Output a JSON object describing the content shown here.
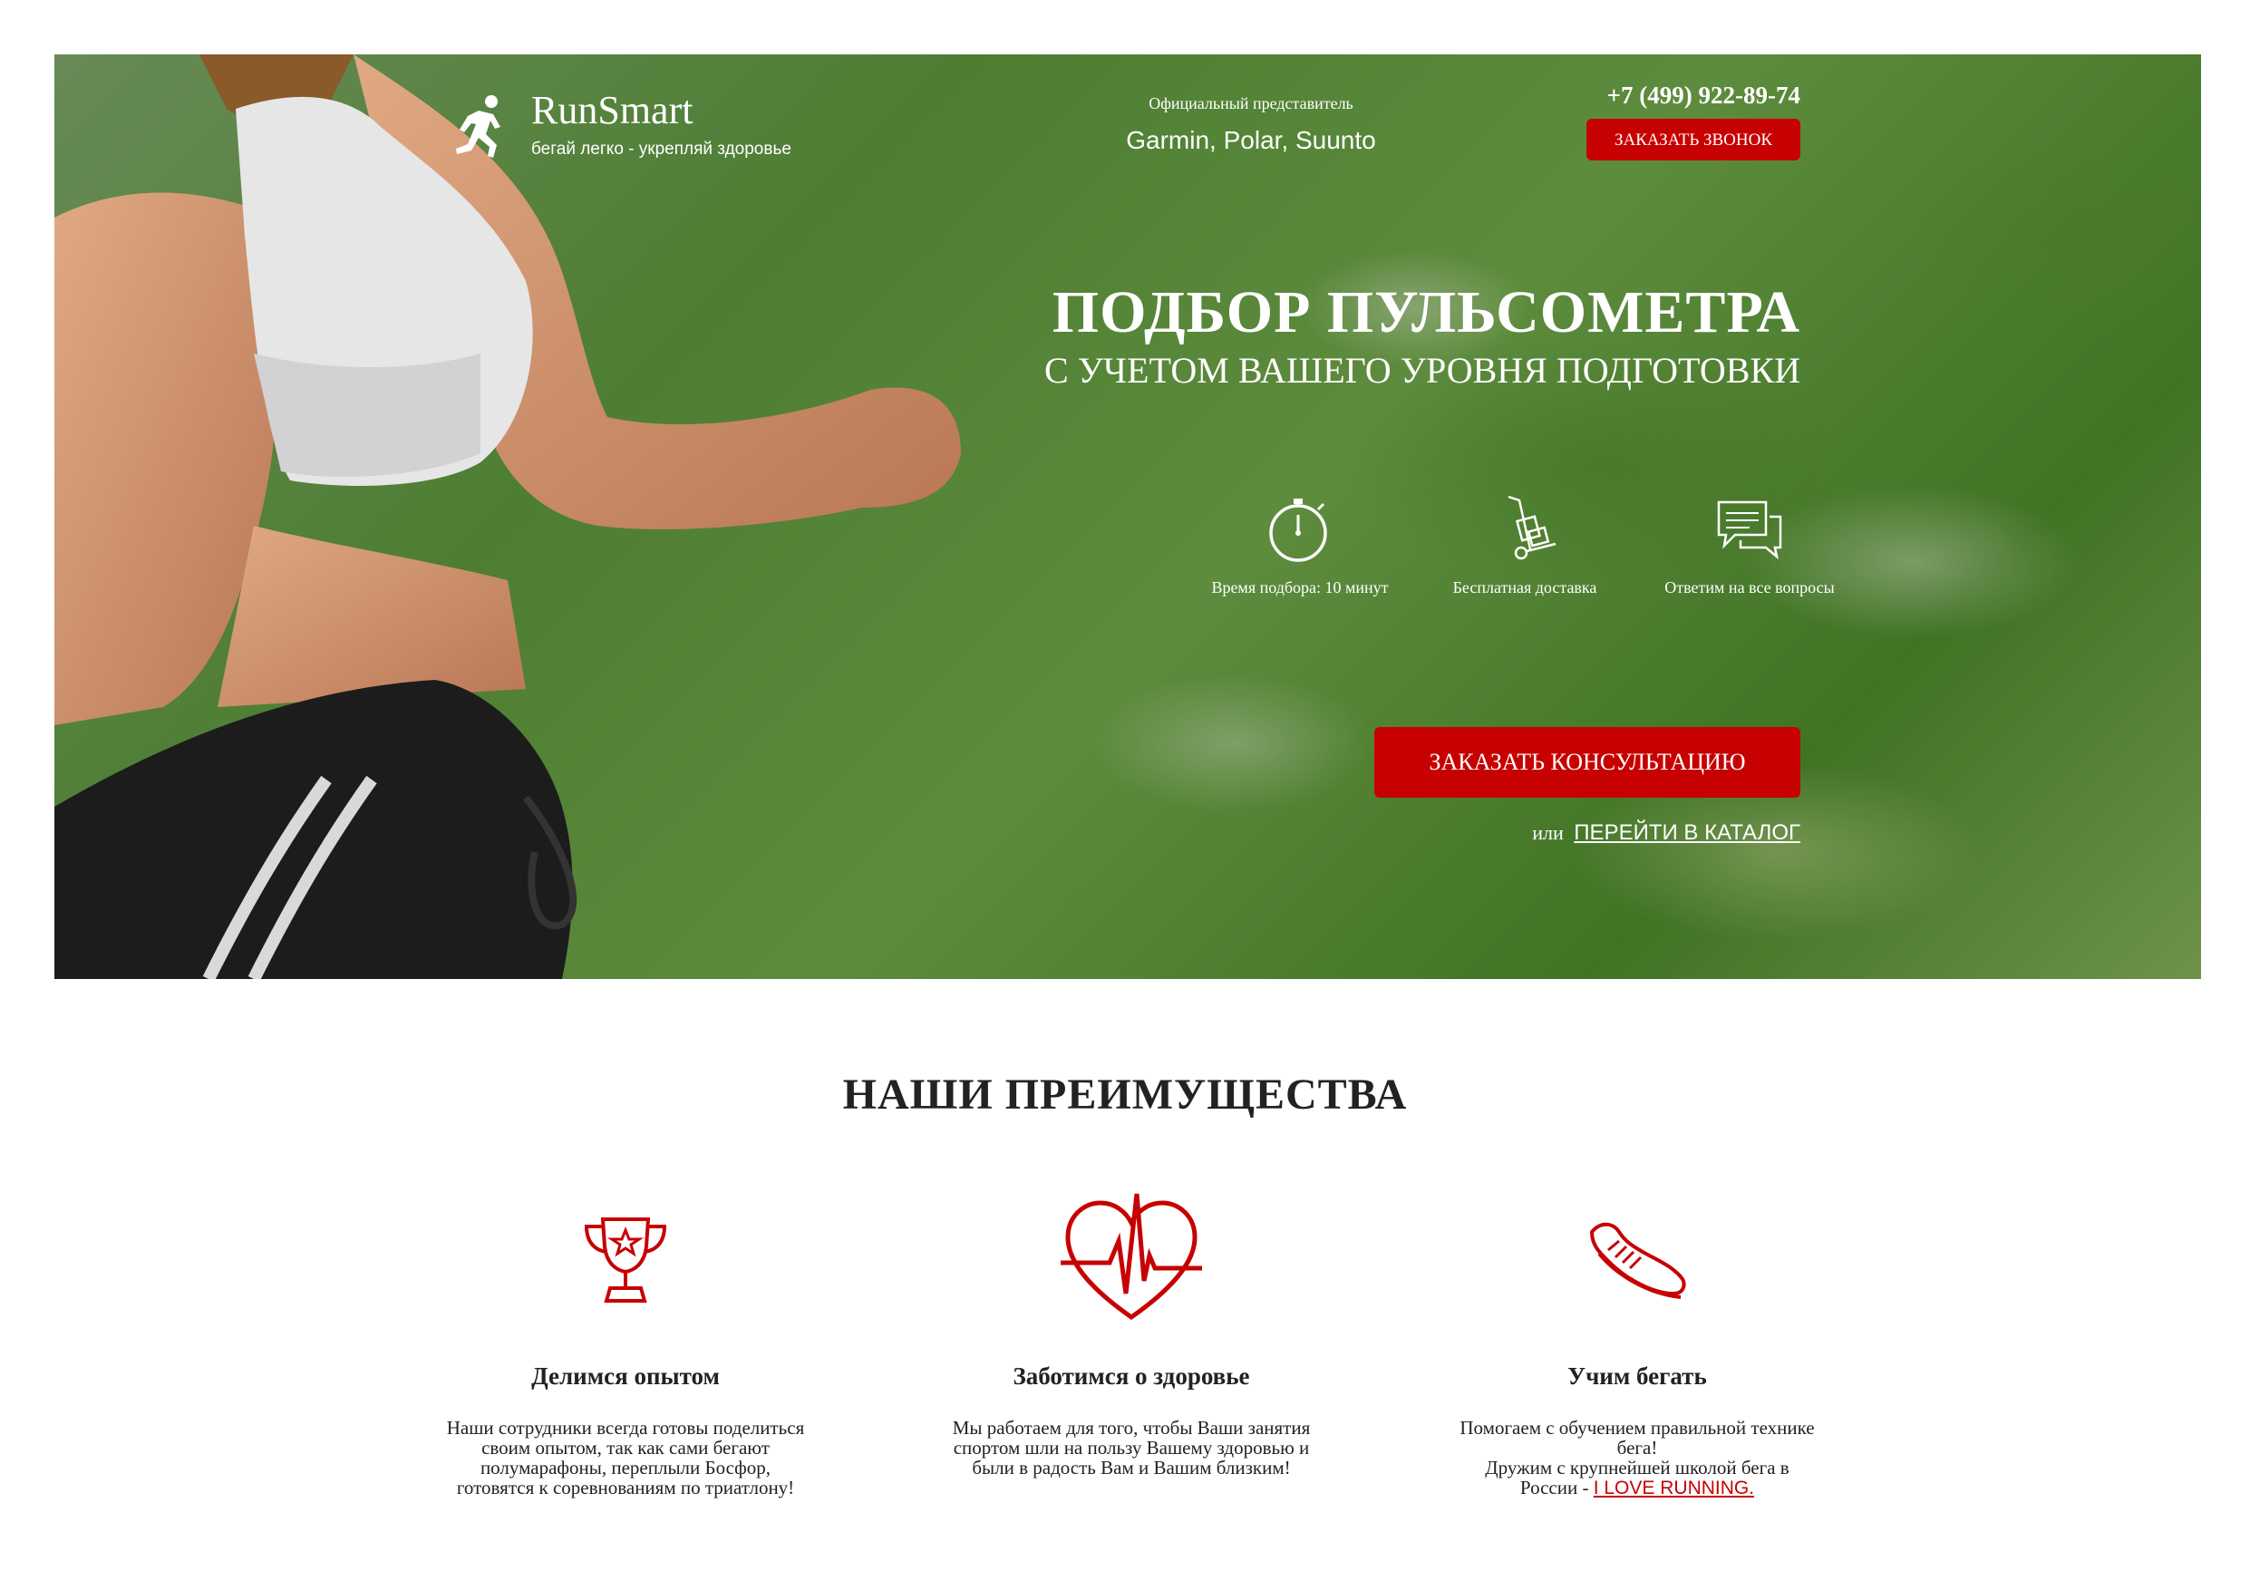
{
  "header": {
    "brand": "RunSmart",
    "slogan": "бегай легко - укрепляй здоровье",
    "rep_label": "Официальный представитель",
    "rep_brands": "Garmin, Polar, Suunto",
    "phone": "+7 (499) 922-89-74",
    "callback_label": "ЗАКАЗАТЬ ЗВОНОК"
  },
  "hero": {
    "title": "ПОДБОР ПУЛЬСОМЕТРА",
    "subtitle": "С УЧЕТОМ ВАШЕГО УРОВНЯ ПОДГОТОВКИ",
    "features": [
      {
        "icon": "stopwatch-icon",
        "text": "Время подбора: 10 минут"
      },
      {
        "icon": "delivery-cart-icon",
        "text": "Бесплатная доставка"
      },
      {
        "icon": "chat-bubbles-icon",
        "text": "Ответим на все вопросы"
      }
    ],
    "consult_label": "ЗАКАЗАТЬ КОНСУЛЬТАЦИЮ",
    "or_label": "или",
    "catalog_label": "ПЕРЕЙТИ В КАТАЛОГ"
  },
  "advantages": {
    "title": "НАШИ ПРЕИМУЩЕСТВА",
    "items": [
      {
        "icon": "trophy-icon",
        "title": "Делимся опытом",
        "text": "Наши сотрудники всегда готовы поделиться своим опытом, так как сами бегают полумарафоны, переплыли Босфор, готовятся к соревнованиям по триатлону!"
      },
      {
        "icon": "heart-pulse-icon",
        "title": "Заботимся о здоровье",
        "text": "Мы работаем для того, чтобы Ваши занятия спортом шли на пользу Вашему здоровью и были в радость Вам и Вашим близким!"
      },
      {
        "icon": "running-shoe-icon",
        "title": "Учим бегать",
        "text_1": "Помогаем с обучением правильной технике бега!",
        "text_2": "Дружим с крупнейшей школой бега в России -",
        "link": "I LOVE RUNNING."
      }
    ]
  },
  "colors": {
    "accent": "#c70101",
    "text": "#222222",
    "white": "#ffffff"
  }
}
